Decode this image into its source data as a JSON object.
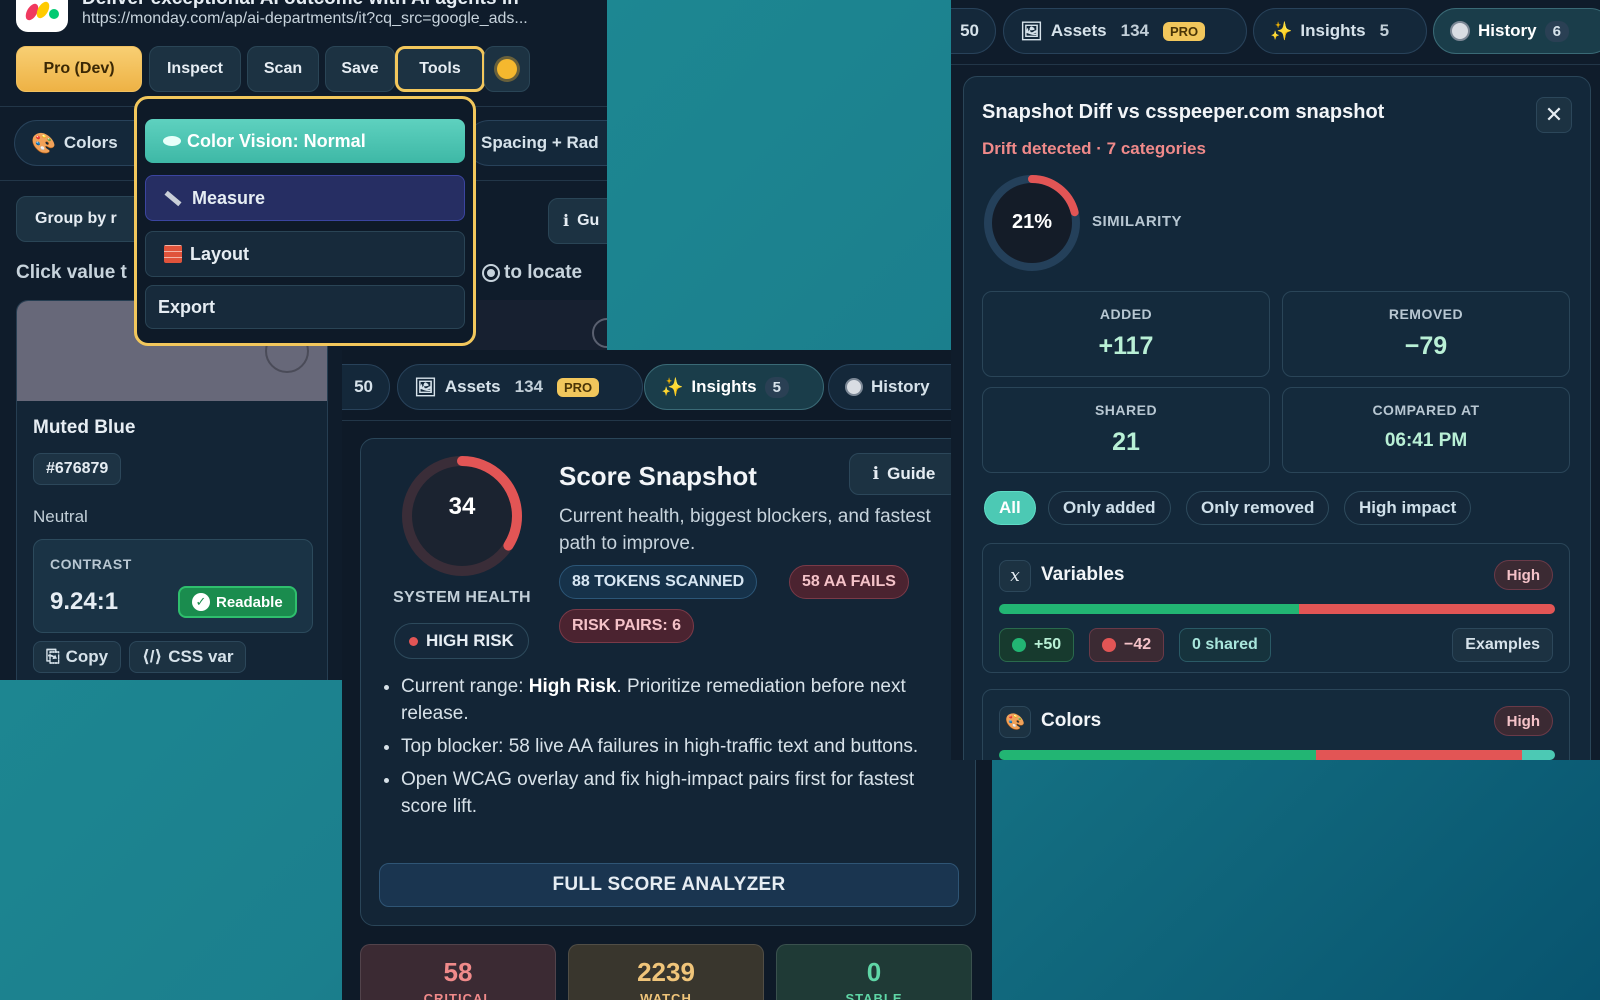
{
  "left": {
    "page_title": "Deliver exceptional AI outcome with AI agents in",
    "url": "https://monday.com/ap/ai-departments/it?cq_src=google_ads...",
    "toolbar": {
      "pro": "Pro (Dev)",
      "inspect": "Inspect",
      "scan": "Scan",
      "save": "Save",
      "tools": "Tools"
    },
    "tabs": {
      "colors": "Colors",
      "spacing": "Spacing + Rad"
    },
    "group_by": "Group by r",
    "guide": "Gu",
    "click_hint": "Click value t",
    "locate_hint": "to locate",
    "menu": {
      "color_vision": "Color Vision: Normal",
      "measure": "Measure",
      "layout": "Layout",
      "export": "Export"
    },
    "color_card": {
      "name": "Muted Blue",
      "hex": "#676879",
      "category": "Neutral",
      "contrast_label": "CONTRAST",
      "contrast_value": "9.24:1",
      "readable": "Readable",
      "copy": "Copy",
      "css_var": "CSS var",
      "swatch": "#676879"
    }
  },
  "middle": {
    "tabs": {
      "partial_count": "50",
      "assets": "Assets",
      "assets_count": "134",
      "pro": "PRO",
      "insights": "Insights",
      "insights_count": "5",
      "history": "History"
    },
    "score": {
      "value": "34",
      "health_label": "SYSTEM HEALTH",
      "risk_badge": "HIGH RISK",
      "title": "Score Snapshot",
      "guide": "Guide",
      "subtitle": "Current health, biggest blockers, and fastest path to improve.",
      "tokens": "88 TOKENS SCANNED",
      "aa_fails": "58 AA FAILS",
      "risk_pairs": "RISK PAIRS: 6",
      "bullet1_pre": "Current range: ",
      "bullet1_bold": "High Risk",
      "bullet1_post": ". Prioritize remediation before next release.",
      "bullet2": "Top blocker: 58 live AA failures in high-traffic text and buttons.",
      "bullet3": "Open WCAG overlay and fix high-impact pairs first for fastest score lift.",
      "full_analyzer": "FULL SCORE ANALYZER",
      "gauge_fraction": 0.34
    },
    "stats": [
      {
        "value": "58",
        "label": "CRITICAL",
        "color": "#f08a8a",
        "bg": "#3b2a33"
      },
      {
        "value": "2239",
        "label": "WATCH",
        "color": "#f0c57a",
        "bg": "#39362d"
      },
      {
        "value": "0",
        "label": "STABLE",
        "color": "#5fd6a6",
        "bg": "#1f3a36"
      }
    ]
  },
  "right": {
    "tabs": {
      "partial_count": "50",
      "assets": "Assets",
      "assets_count": "134",
      "pro": "PRO",
      "insights": "Insights",
      "insights_count": "5",
      "history": "History",
      "history_count": "6"
    },
    "diff": {
      "title": "Snapshot Diff vs csspeeper.com snapshot",
      "drift": "Drift detected · 7 categories",
      "similarity": "21%",
      "similarity_label": "SIMILARITY",
      "similarity_fraction": 0.21,
      "added_label": "ADDED",
      "added": "+117",
      "removed_label": "REMOVED",
      "removed": "−79",
      "shared_label": "SHARED",
      "shared": "21",
      "compared_label": "COMPARED AT",
      "compared": "06:41 PM",
      "filters": [
        "All",
        "Only added",
        "Only removed",
        "High impact"
      ],
      "variables": {
        "name": "Variables",
        "impact": "High",
        "added": "+50",
        "removed": "−42",
        "shared": "0 shared",
        "examples": "Examples",
        "added_fraction": 0.54,
        "removed_fraction": 0.46,
        "shared_fraction": 0
      },
      "colors": {
        "name": "Colors",
        "impact": "High",
        "added_fraction": 0.57,
        "removed_fraction": 0.37,
        "shared_fraction": 0.06
      }
    }
  },
  "colors": {
    "accent_teal": "#4cc9b4",
    "danger": "#e25555",
    "success": "#22b573",
    "warning": "#f2c75c"
  }
}
